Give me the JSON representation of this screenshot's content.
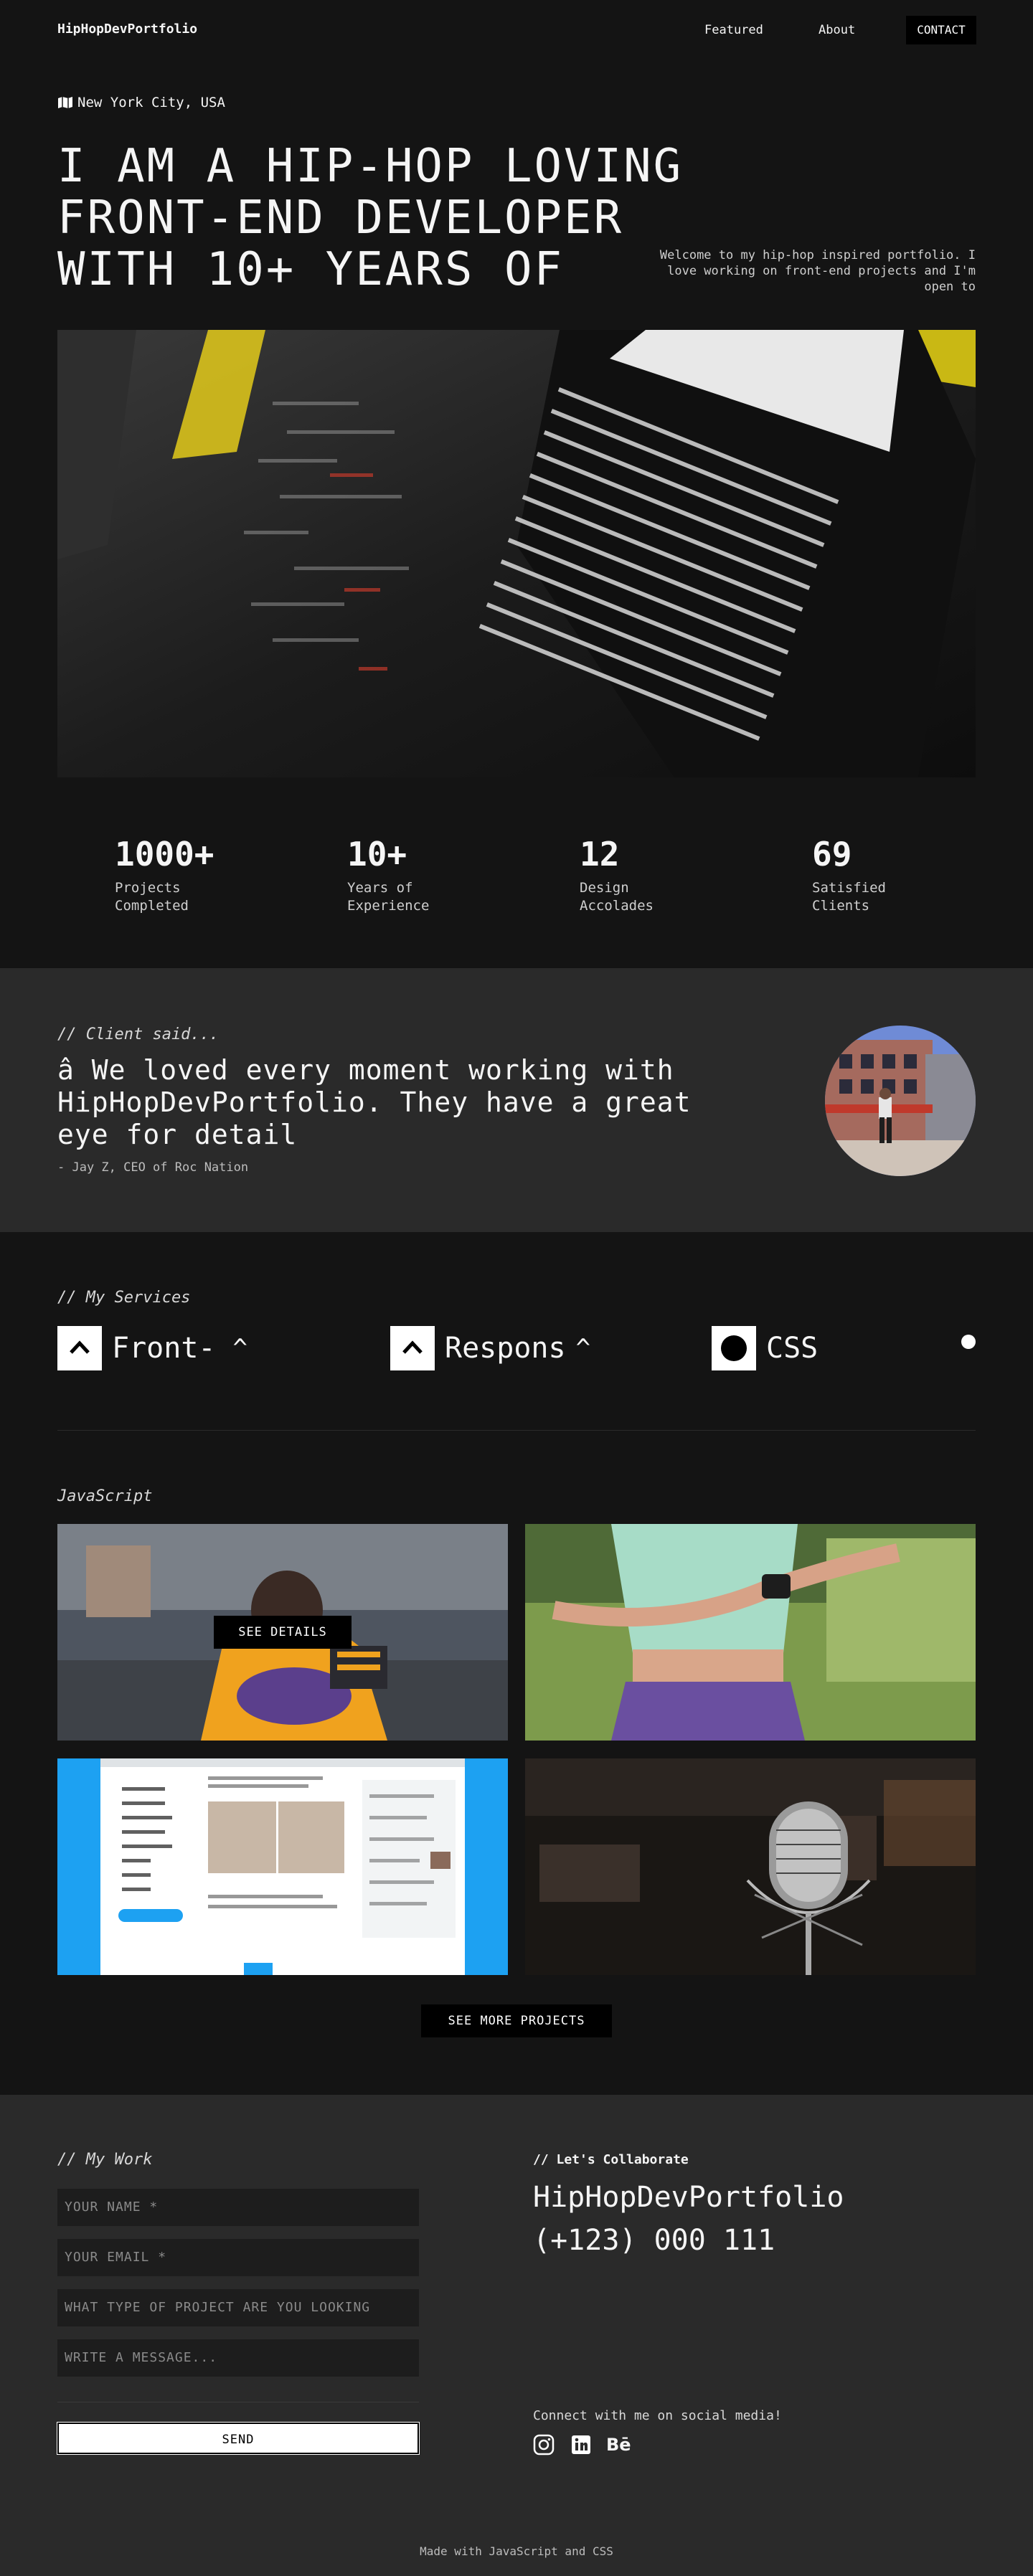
{
  "nav": {
    "brand": "HipHopDevPortfolio",
    "featured": "Featured",
    "about": "About",
    "contact": "CONTACT"
  },
  "hero": {
    "location": "New York City, USA",
    "title": "I AM A HIP-HOP LOVING FRONT-END DEVELOPER WITH 10+ YEARS OF",
    "intro": "Welcome to my hip-hop inspired portfolio. I love working on front-end projects and I'm open to"
  },
  "stats": [
    {
      "value": "1000+",
      "label": "Projects Completed"
    },
    {
      "value": "10+",
      "label": "Years of Experience"
    },
    {
      "value": "12",
      "label": "Design Accolades"
    },
    {
      "value": "69",
      "label": "Satisfied Clients"
    }
  ],
  "testimonial": {
    "kicker": "// Client said...",
    "quote": "â  We loved every moment working with HipHopDevPortfolio. They have a great eye for detail",
    "author": "- Jay Z, CEO of Roc Nation"
  },
  "services": {
    "kicker": "// My Services",
    "items": [
      {
        "label": "Front-",
        "icon": "chevron-up-icon"
      },
      {
        "label": "Respons",
        "icon": "chevron-up-icon"
      },
      {
        "label": "CSS",
        "icon": "circle-icon"
      }
    ],
    "caret": "^"
  },
  "projects": {
    "kicker": "JavaScript",
    "details_label": "SEE DETAILS",
    "see_more": "SEE MORE PROJECTS"
  },
  "contact": {
    "kicker": "// My Work",
    "name_placeholder": "YOUR NAME *",
    "email_placeholder": "YOUR EMAIL *",
    "project_placeholder": "WHAT TYPE OF PROJECT ARE YOU LOOKING FOR?",
    "message_placeholder": "WRITE A MESSAGE...",
    "send": "SEND",
    "collab_kicker": "// Let's Collaborate",
    "collab_name": "HipHopDevPortfolio",
    "phone": "(+123) 000 111",
    "social_label": "Connect with me on social media!",
    "social_icons": [
      "instagram-icon",
      "linkedin-icon",
      "behance-icon"
    ],
    "behance_glyph": "Bē"
  },
  "footer": "Made with JavaScript and CSS",
  "colors": {
    "background": "#141414",
    "panel": "#2a2a2a",
    "accent_yellow": "#d9c21c",
    "twitter_blue": "#1da1f2"
  }
}
